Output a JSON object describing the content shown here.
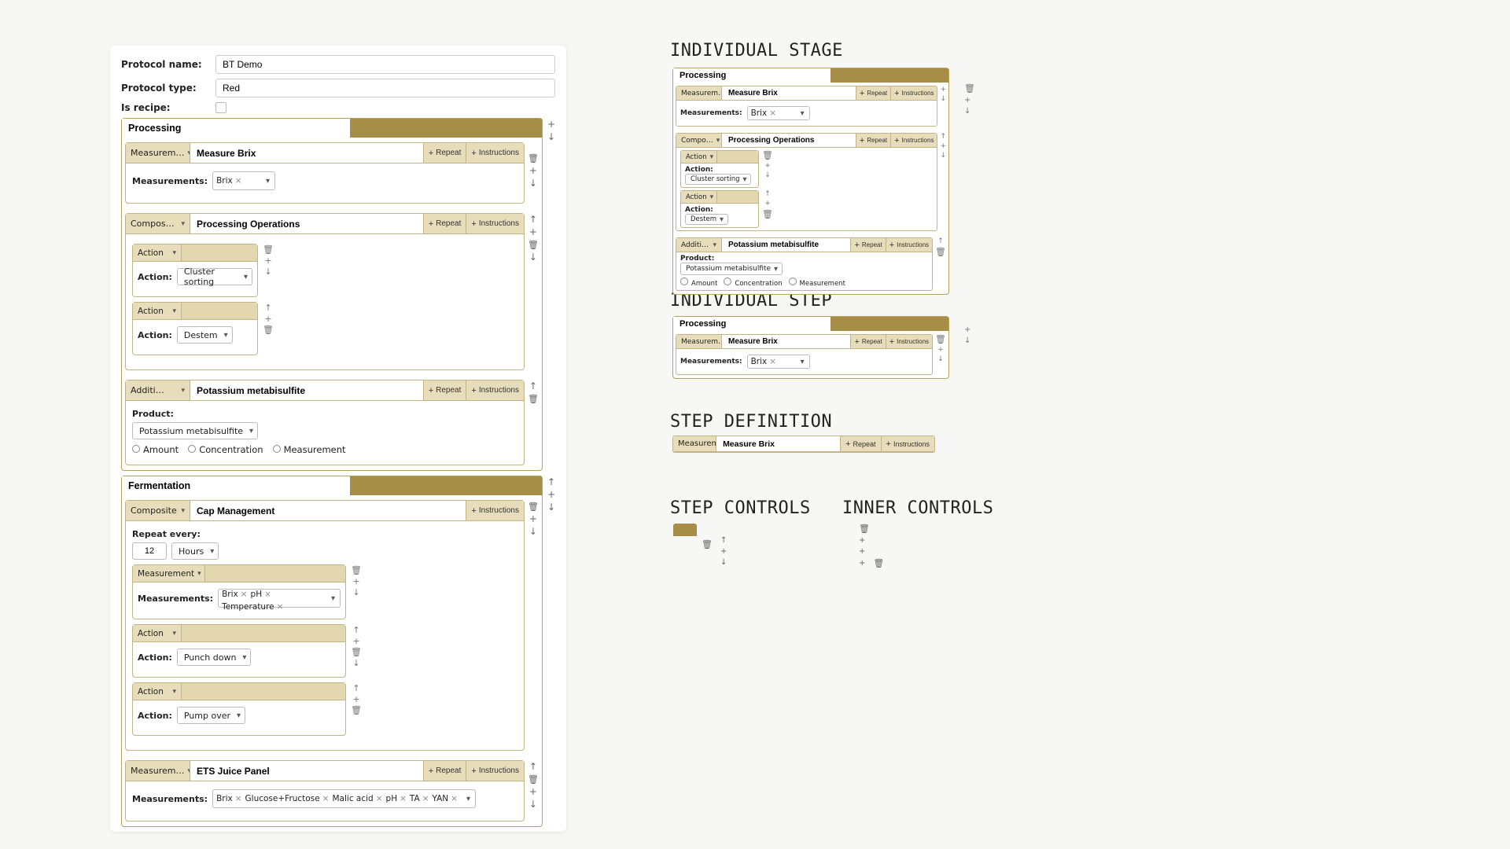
{
  "meta": {
    "name_label": "Protocol name:",
    "name_value": "BT Demo",
    "type_label": "Protocol type:",
    "type_value": "Red",
    "recipe_label": "Is recipe:"
  },
  "common": {
    "repeat": "Repeat",
    "instructions": "Instructions",
    "plus": "+",
    "measurements_label": "Measurements:",
    "action_label": "Action:",
    "product_label": "Product:",
    "repeat_every_label": "Repeat every:"
  },
  "stages": [
    {
      "title": "Processing",
      "steps": [
        {
          "type": "Measurem…",
          "name": "Measure Brix",
          "tags": [
            "Brix"
          ]
        },
        {
          "type": "Compos…",
          "name": "Processing Operations",
          "sub": [
            {
              "type": "Action",
              "action": "Cluster sorting"
            },
            {
              "type": "Action",
              "action": "Destem"
            }
          ]
        },
        {
          "type": "Additi…",
          "name": "Potassium metabisulfite",
          "product": "Potassium metabisulfite",
          "radios": [
            "Amount",
            "Concentration",
            "Measurement"
          ]
        }
      ]
    },
    {
      "title": "Fermentation",
      "steps": [
        {
          "type": "Composite",
          "name": "Cap Management",
          "repeat_qty": "12",
          "repeat_unit": "Hours",
          "sub": [
            {
              "type": "Measurement",
              "tags": [
                "Brix",
                "pH",
                "Temperature"
              ]
            },
            {
              "type": "Action",
              "action": "Punch down"
            },
            {
              "type": "Action",
              "action": "Pump over"
            }
          ]
        },
        {
          "type": "Measurem…",
          "name": "ETS Juice Panel",
          "tags": [
            "Brix",
            "Glucose+Fructose",
            "Malic acid",
            "pH",
            "TA",
            "YAN"
          ]
        }
      ]
    }
  ],
  "annot": {
    "t1": "INDIVIDUAL STAGE",
    "t2": "INDIVIDUAL STEP",
    "t3": "STEP DEFINITION",
    "t4": "STEP CONTROLS",
    "t5": "INNER CONTROLS"
  },
  "mini_stage": {
    "title": "Processing",
    "step1": {
      "type": "Measurem…",
      "name": "Measure Brix",
      "tags": [
        "Brix"
      ]
    },
    "step2": {
      "type": "Compo…",
      "name": "Processing Operations",
      "sub": [
        {
          "type": "Action",
          "action": "Cluster sorting"
        },
        {
          "type": "Action",
          "action": "Destem"
        }
      ]
    },
    "step3": {
      "type": "Additi…",
      "name": "Potassium metabisulfite",
      "product": "Potassium metabisulfite",
      "radios": [
        "Amount",
        "Concentration",
        "Measurement"
      ]
    }
  },
  "mini_step": {
    "title": "Processing",
    "step": {
      "type": "Measurem…",
      "name": "Measure Brix",
      "tags": [
        "Brix"
      ]
    }
  },
  "step_def": {
    "type": "Measurem…",
    "name": "Measure Brix"
  }
}
